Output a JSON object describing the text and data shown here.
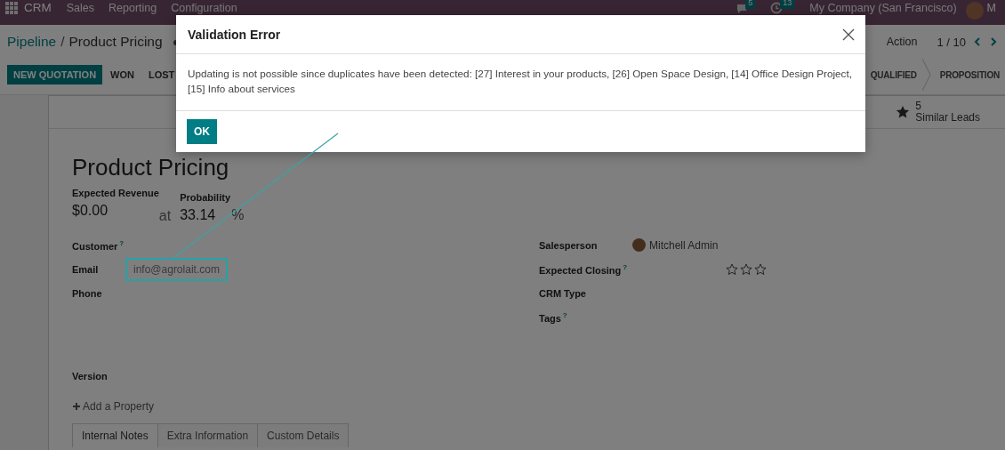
{
  "navbar": {
    "app_name": "CRM",
    "menu": [
      "Sales",
      "Reporting",
      "Configuration"
    ],
    "messages_badge": "5",
    "activities_badge": "13",
    "company": "My Company (San Francisco)",
    "user_name": "M"
  },
  "breadcrumb": {
    "parent": "Pipeline",
    "separator": "/",
    "current": "Product Pricing"
  },
  "action_menu": "Action",
  "pager": "1 / 10",
  "buttons": [
    {
      "label": "NEW QUOTATION",
      "kind": "primary"
    },
    {
      "label": "WON",
      "kind": "secondary"
    },
    {
      "label": "LOST",
      "kind": "secondary"
    }
  ],
  "stages": [
    {
      "label": "QUALIFIED",
      "selected": false
    },
    {
      "label": "PROPOSITION",
      "selected": false
    }
  ],
  "smart_buttons": [
    {
      "count": "5",
      "label": "Similar Leads"
    }
  ],
  "record": {
    "title": "Product Pricing",
    "revenue": {
      "label": "Expected Revenue",
      "value": "$0.00",
      "connector": "at"
    },
    "probability": {
      "label": "Probability",
      "value": "33.14",
      "unit": "%"
    },
    "left_fields": [
      {
        "label": "Customer",
        "help": "?",
        "kind": "text"
      },
      {
        "label": "Email",
        "kind": "email",
        "value": "info@agrolait.com",
        "highlighted": true
      },
      {
        "label": "Phone",
        "kind": "text"
      }
    ],
    "right_fields": [
      {
        "label": "Salesperson",
        "kind": "user",
        "value": "Mitchell Admin"
      },
      {
        "label": "Expected Closing",
        "help": "?",
        "kind": "priority",
        "stars": 0
      },
      {
        "label": "CRM Type",
        "kind": "text"
      },
      {
        "label": "Tags",
        "help": "?",
        "kind": "text"
      }
    ],
    "version_label": "Version",
    "add_property": "Add a Property",
    "tabs": [
      {
        "label": "Internal Notes",
        "selected": true
      },
      {
        "label": "Extra Information",
        "selected": false
      },
      {
        "label": "Custom Details",
        "selected": false
      }
    ]
  },
  "dialog": {
    "title": "Validation Error",
    "message": "Updating is not possible since duplicates have been detected: [27] Interest in your products, [26] Open Space Design, [14] Office Design Project, [15] Info about services",
    "buttons": [
      "OK"
    ]
  }
}
